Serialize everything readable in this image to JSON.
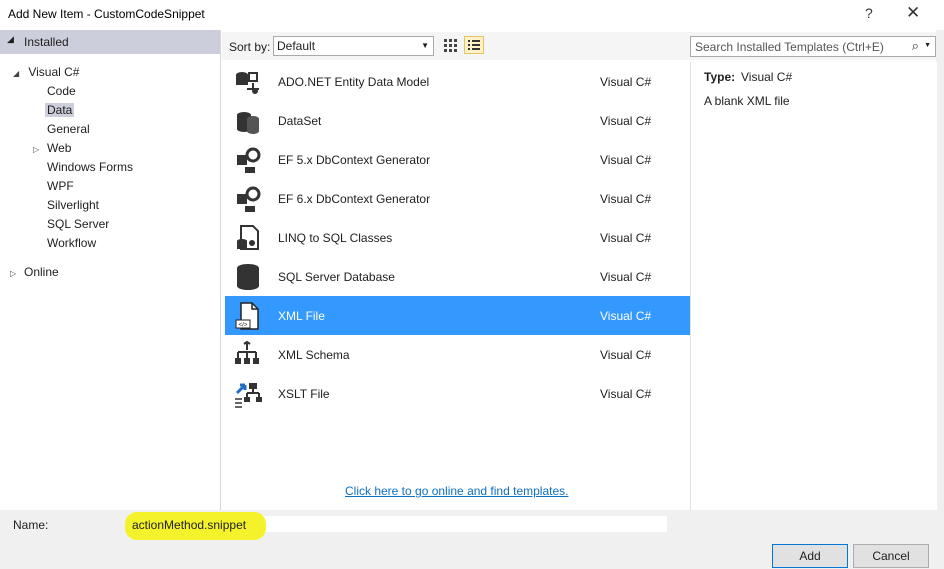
{
  "window": {
    "title": "Add New Item - CustomCodeSnippet",
    "help": "?",
    "close": "✕"
  },
  "tree": {
    "installed": "Installed",
    "visual_csharp": "Visual C#",
    "children": [
      "Code",
      "Data",
      "General",
      "Web",
      "Windows Forms",
      "WPF",
      "Silverlight",
      "SQL Server",
      "Workflow"
    ],
    "online": "Online"
  },
  "toolbar": {
    "sort_label": "Sort by:",
    "sort_value": "Default",
    "search_placeholder": "Search Installed Templates (Ctrl+E)"
  },
  "templates": [
    {
      "name": "ADO.NET Entity Data Model",
      "lang": "Visual C#",
      "icon": "entity-model-icon"
    },
    {
      "name": "DataSet",
      "lang": "Visual C#",
      "icon": "dataset-icon"
    },
    {
      "name": "EF 5.x DbContext Generator",
      "lang": "Visual C#",
      "icon": "ef-generator-icon"
    },
    {
      "name": "EF 6.x DbContext Generator",
      "lang": "Visual C#",
      "icon": "ef-generator-icon"
    },
    {
      "name": "LINQ to SQL Classes",
      "lang": "Visual C#",
      "icon": "linq-sql-icon"
    },
    {
      "name": "SQL Server Database",
      "lang": "Visual C#",
      "icon": "database-icon"
    },
    {
      "name": "XML File",
      "lang": "Visual C#",
      "icon": "xml-file-icon"
    },
    {
      "name": "XML Schema",
      "lang": "Visual C#",
      "icon": "xml-schema-icon"
    },
    {
      "name": "XSLT File",
      "lang": "Visual C#",
      "icon": "xslt-file-icon"
    }
  ],
  "online_link": "Click here to go online and find templates.",
  "details": {
    "type_label": "Type:",
    "type_value": "Visual C#",
    "description": "A blank XML file"
  },
  "footer": {
    "name_label": "Name:",
    "name_value": "actionMethod.snippet",
    "add": "Add",
    "cancel": "Cancel"
  },
  "colors": {
    "selection": "#3399ff",
    "tree_selection": "#cccedb",
    "link": "#0e70c0",
    "highlight": "#f4f22a"
  }
}
